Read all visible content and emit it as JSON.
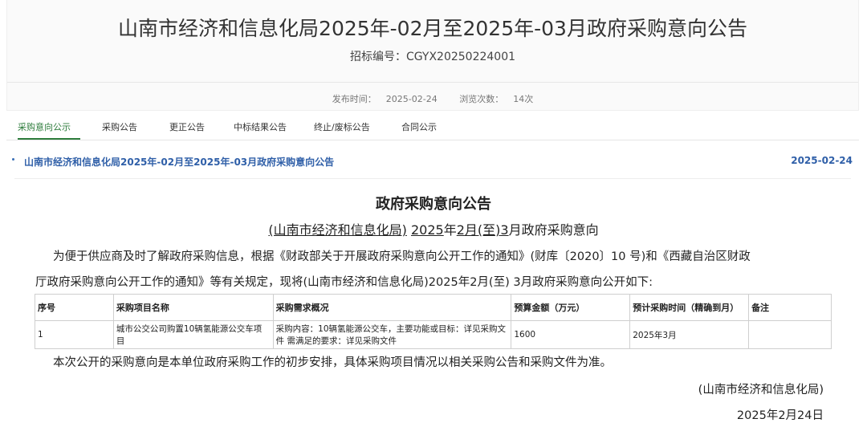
{
  "header": {
    "title": "山南市经济和信息化局2025年-02月至2025年-03月政府采购意向公告",
    "bid_number_label": "招标编号：",
    "bid_number": "CGYX20250224001",
    "publish_label": "发布时间：",
    "publish_date": "2025-02-24",
    "views_label": "浏览次数：",
    "views": "14次"
  },
  "tabs": [
    "采购意向公示",
    "采购公告",
    "更正公告",
    "中标结果公告",
    "终止/废标公告",
    "合同公示"
  ],
  "list": {
    "link": "山南市经济和信息化局2025年-02月至2025年-03月政府采购意向公告",
    "date": "2025-02-24"
  },
  "document": {
    "title": "政府采购意向公告",
    "subtitle_org": "(山南市经济和信息化局)",
    "subtitle_year": "2025",
    "subtitle_year_suffix": "年",
    "subtitle_m1": "2",
    "subtitle_mid": "月(至)",
    "subtitle_m2": "3",
    "subtitle_tail": "月政府采购意向",
    "para1_line1": "为便于供应商及时了解政府采购信息，根据《财政部关于开展政府采购意向公开工作的通知》(财库〔2020〕10 号)和《西藏自治区财政",
    "para1_line2": "厅政府采购意向公开工作的通知》等有关规定，现将(山南市经济和信息化局)2025年2月(至) 3月政府采购意向公开如下:",
    "table_headers": [
      "序号",
      "采购项目名称",
      "采购需求概况",
      "预算金额（万元）",
      "预计采购时间（精确到月）",
      "备注"
    ],
    "table_rows": [
      [
        "1",
        "城市公交公司购置10辆氢能源公交车项目",
        "采购内容：10辆氢能源公交车，主要功能或目标：详见采购文件 需满足的要求：详见采购文件",
        "1600",
        "2025年3月",
        ""
      ]
    ],
    "para2": "本次公开的采购意向是本单位政府采购工作的初步安排，具体采购项目情况以相关采购公告和采购文件为准。",
    "sign_org": "(山南市经济和信息化局)",
    "sign_date": "2025年2月24日"
  }
}
